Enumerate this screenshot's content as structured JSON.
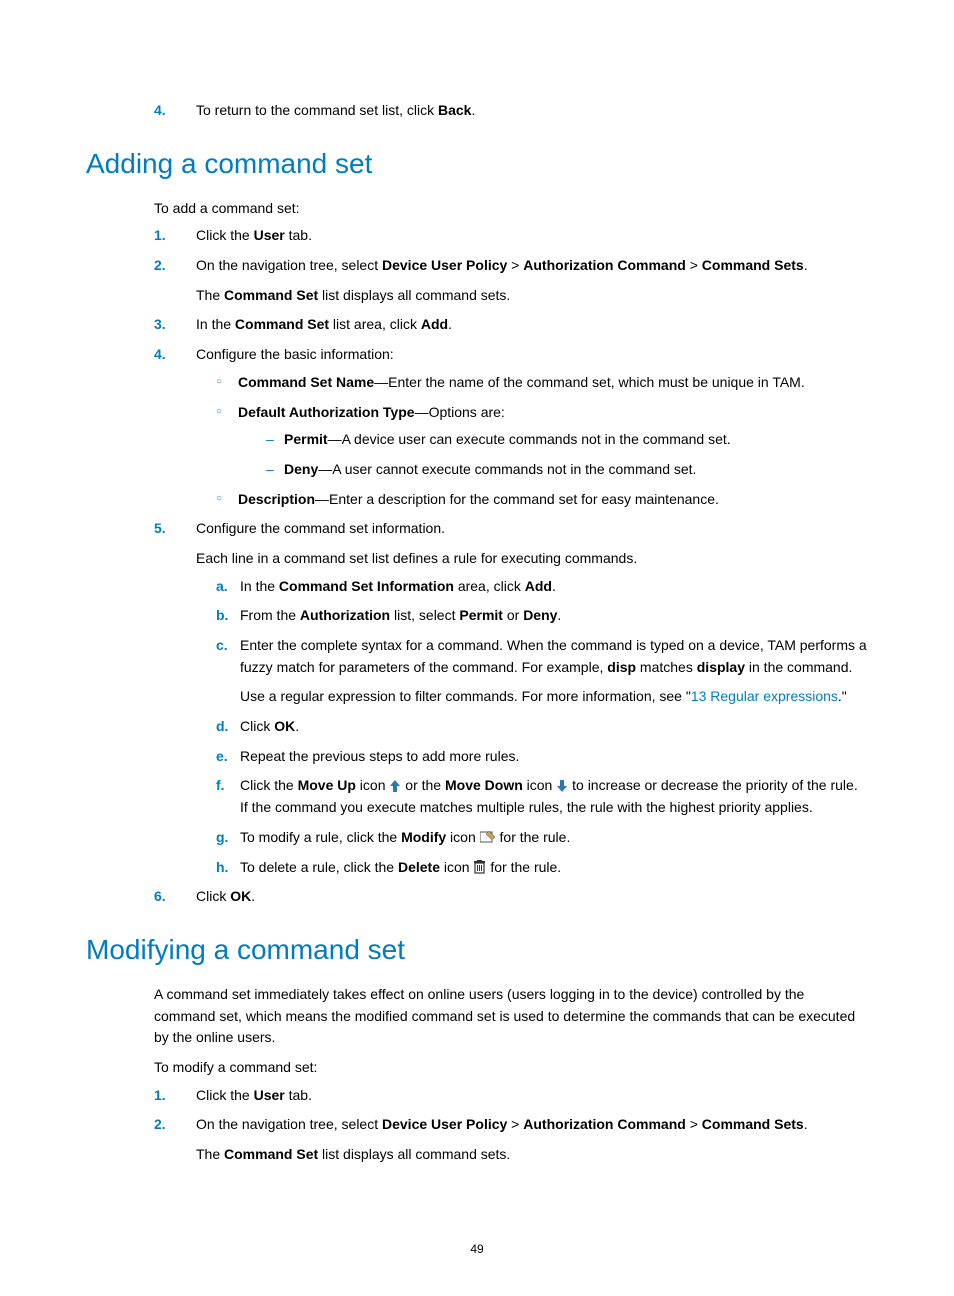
{
  "topList": {
    "item4": {
      "marker": "4.",
      "text_a": "To return to the command set list, click ",
      "bold_a": "Back",
      "text_b": "."
    }
  },
  "adding": {
    "heading": "Adding a command set",
    "intro": "To add a command set:",
    "s1": {
      "marker": "1.",
      "text_a": "Click the ",
      "bold_a": "User",
      "text_b": " tab."
    },
    "s2": {
      "marker": "2.",
      "text_a": "On the navigation tree, select ",
      "bold_a": "Device User Policy",
      "gt1": " > ",
      "bold_b": "Authorization Command",
      "gt2": " > ",
      "bold_c": "Command Sets",
      "text_b": ".",
      "line2_a": "The ",
      "line2_bold": "Command Set",
      "line2_b": " list displays all command sets."
    },
    "s3": {
      "marker": "3.",
      "text_a": "In the ",
      "bold_a": "Command Set",
      "text_b": " list area, click ",
      "bold_b": "Add",
      "text_c": "."
    },
    "s4": {
      "marker": "4.",
      "text": "Configure the basic information:",
      "b1": {
        "bold": "Command Set Name",
        "text": "—Enter the name of the command set, which must be unique in TAM."
      },
      "b2": {
        "bold": "Default Authorization Type",
        "text": "—Options are:",
        "d1": {
          "bold": "Permit",
          "text": "—A device user can execute commands not in the command set."
        },
        "d2": {
          "bold": "Deny",
          "text": "—A user cannot execute commands not in the command set."
        }
      },
      "b3": {
        "bold": "Description",
        "text": "—Enter a description for the command set for easy maintenance."
      }
    },
    "s5": {
      "marker": "5.",
      "text": "Configure the command set information.",
      "line2": "Each line in a command set list defines a rule for executing commands.",
      "a": {
        "marker": "a.",
        "text_a": "In the ",
        "bold_a": "Command Set Information",
        "text_b": " area, click ",
        "bold_b": "Add",
        "text_c": "."
      },
      "b": {
        "marker": "b.",
        "text_a": "From the ",
        "bold_a": "Authorization",
        "text_b": " list, select ",
        "bold_b": "Permit",
        "text_c": " or ",
        "bold_c": "Deny",
        "text_d": "."
      },
      "c": {
        "marker": "c.",
        "text_a": "Enter the complete syntax for a command. When the command is typed on a device, TAM performs a fuzzy match for parameters of the command. For example, ",
        "bold_a": "disp",
        "text_b": " matches ",
        "bold_b": "display",
        "text_c": " in the command.",
        "line2_a": "Use a regular expression to filter commands. For more information, see \"",
        "link": "13 Regular expressions",
        "line2_b": ".\""
      },
      "d": {
        "marker": "d.",
        "text_a": "Click ",
        "bold_a": "OK",
        "text_b": "."
      },
      "e": {
        "marker": "e.",
        "text": "Repeat the previous steps to add more rules."
      },
      "f": {
        "marker": "f.",
        "text_a": "Click the ",
        "bold_a": "Move Up",
        "text_b": " icon ",
        "text_c": " or the ",
        "bold_b": "Move Down",
        "text_d": " icon ",
        "text_e": " to increase or decrease the priority of the rule. If the command you execute matches multiple rules, the rule with the highest priority applies."
      },
      "g": {
        "marker": "g.",
        "text_a": "To modify a rule, click the ",
        "bold_a": "Modify",
        "text_b": " icon ",
        "text_c": " for the rule."
      },
      "h": {
        "marker": "h.",
        "text_a": "To delete a rule, click the ",
        "bold_a": "Delete",
        "text_b": " icon ",
        "text_c": " for the rule."
      }
    },
    "s6": {
      "marker": "6.",
      "text_a": "Click ",
      "bold_a": "OK",
      "text_b": "."
    }
  },
  "modifying": {
    "heading": "Modifying a command set",
    "para": "A command set immediately takes effect on online users (users logging in to the device) controlled by the command set, which means the modified command set is used to determine the commands that can be executed by the online users.",
    "intro": "To modify a command set:",
    "s1": {
      "marker": "1.",
      "text_a": "Click the ",
      "bold_a": "User",
      "text_b": " tab."
    },
    "s2": {
      "marker": "2.",
      "text_a": "On the navigation tree, select ",
      "bold_a": "Device User Policy",
      "gt1": " > ",
      "bold_b": "Authorization Command",
      "gt2": " > ",
      "bold_c": "Command Sets",
      "text_b": ".",
      "line2_a": "The ",
      "line2_bold": "Command Set",
      "line2_b": " list displays all command sets."
    }
  },
  "pageNumber": "49"
}
